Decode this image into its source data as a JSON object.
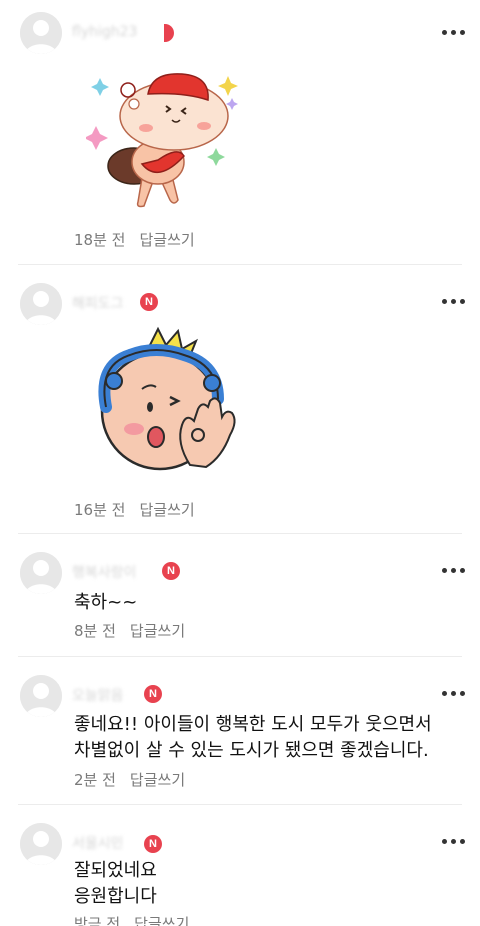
{
  "comments": [
    {
      "nickname": "flyhigh23",
      "badge": "",
      "time": "18분 전",
      "reply": "답글쓰기",
      "sticker": "hamster-sticker",
      "text": []
    },
    {
      "nickname": "해피도그",
      "badge": "N",
      "time": "16분 전",
      "reply": "답글쓰기",
      "sticker": "baby-ok-sticker",
      "text": []
    },
    {
      "nickname": "행복사랑이",
      "badge": "N",
      "time": "8분 전",
      "reply": "답글쓰기",
      "sticker": "",
      "text": [
        "축하~~"
      ]
    },
    {
      "nickname": "오늘맑음",
      "badge": "N",
      "time": "2분 전",
      "reply": "답글쓰기",
      "sticker": "",
      "text": [
        "좋네요!! 아이들이 행복한 도시 모두가 웃으면서",
        "차별없이 살 수 있는 도시가 됐으면 좋겠습니다."
      ]
    },
    {
      "nickname": "서울시민",
      "badge": "N",
      "time": "방금 전",
      "reply": "답글쓰기",
      "sticker": "",
      "text": [
        "잘되었네요",
        "응원합니다"
      ]
    }
  ],
  "icons": {
    "more": "more-dots-icon",
    "avatar": "default-avatar-icon"
  },
  "colors": {
    "badge": "#e8424f",
    "meta": "#7a7a7a",
    "divider": "#ececec"
  }
}
